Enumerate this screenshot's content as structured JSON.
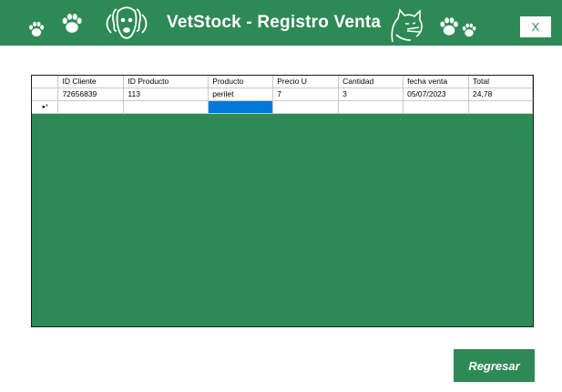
{
  "window": {
    "title": "VetStock - Registro Venta",
    "close_label": "X"
  },
  "grid": {
    "columns": [
      "ID Cliente",
      "ID Producto",
      "Producto",
      "Precio U",
      "Cantidad",
      "fecha venta",
      "Total"
    ],
    "rows": [
      [
        "72656839",
        "113",
        "perilet",
        "7",
        "3",
        "05/07/2023",
        "24,78"
      ]
    ],
    "new_row_marker": "▸*"
  },
  "footer": {
    "back_label": "Regresar"
  },
  "colors": {
    "brand_green": "#2e8a55",
    "selection_blue": "#0078d7"
  },
  "icons": [
    "paw-icon",
    "dog-icon",
    "cat-icon"
  ]
}
